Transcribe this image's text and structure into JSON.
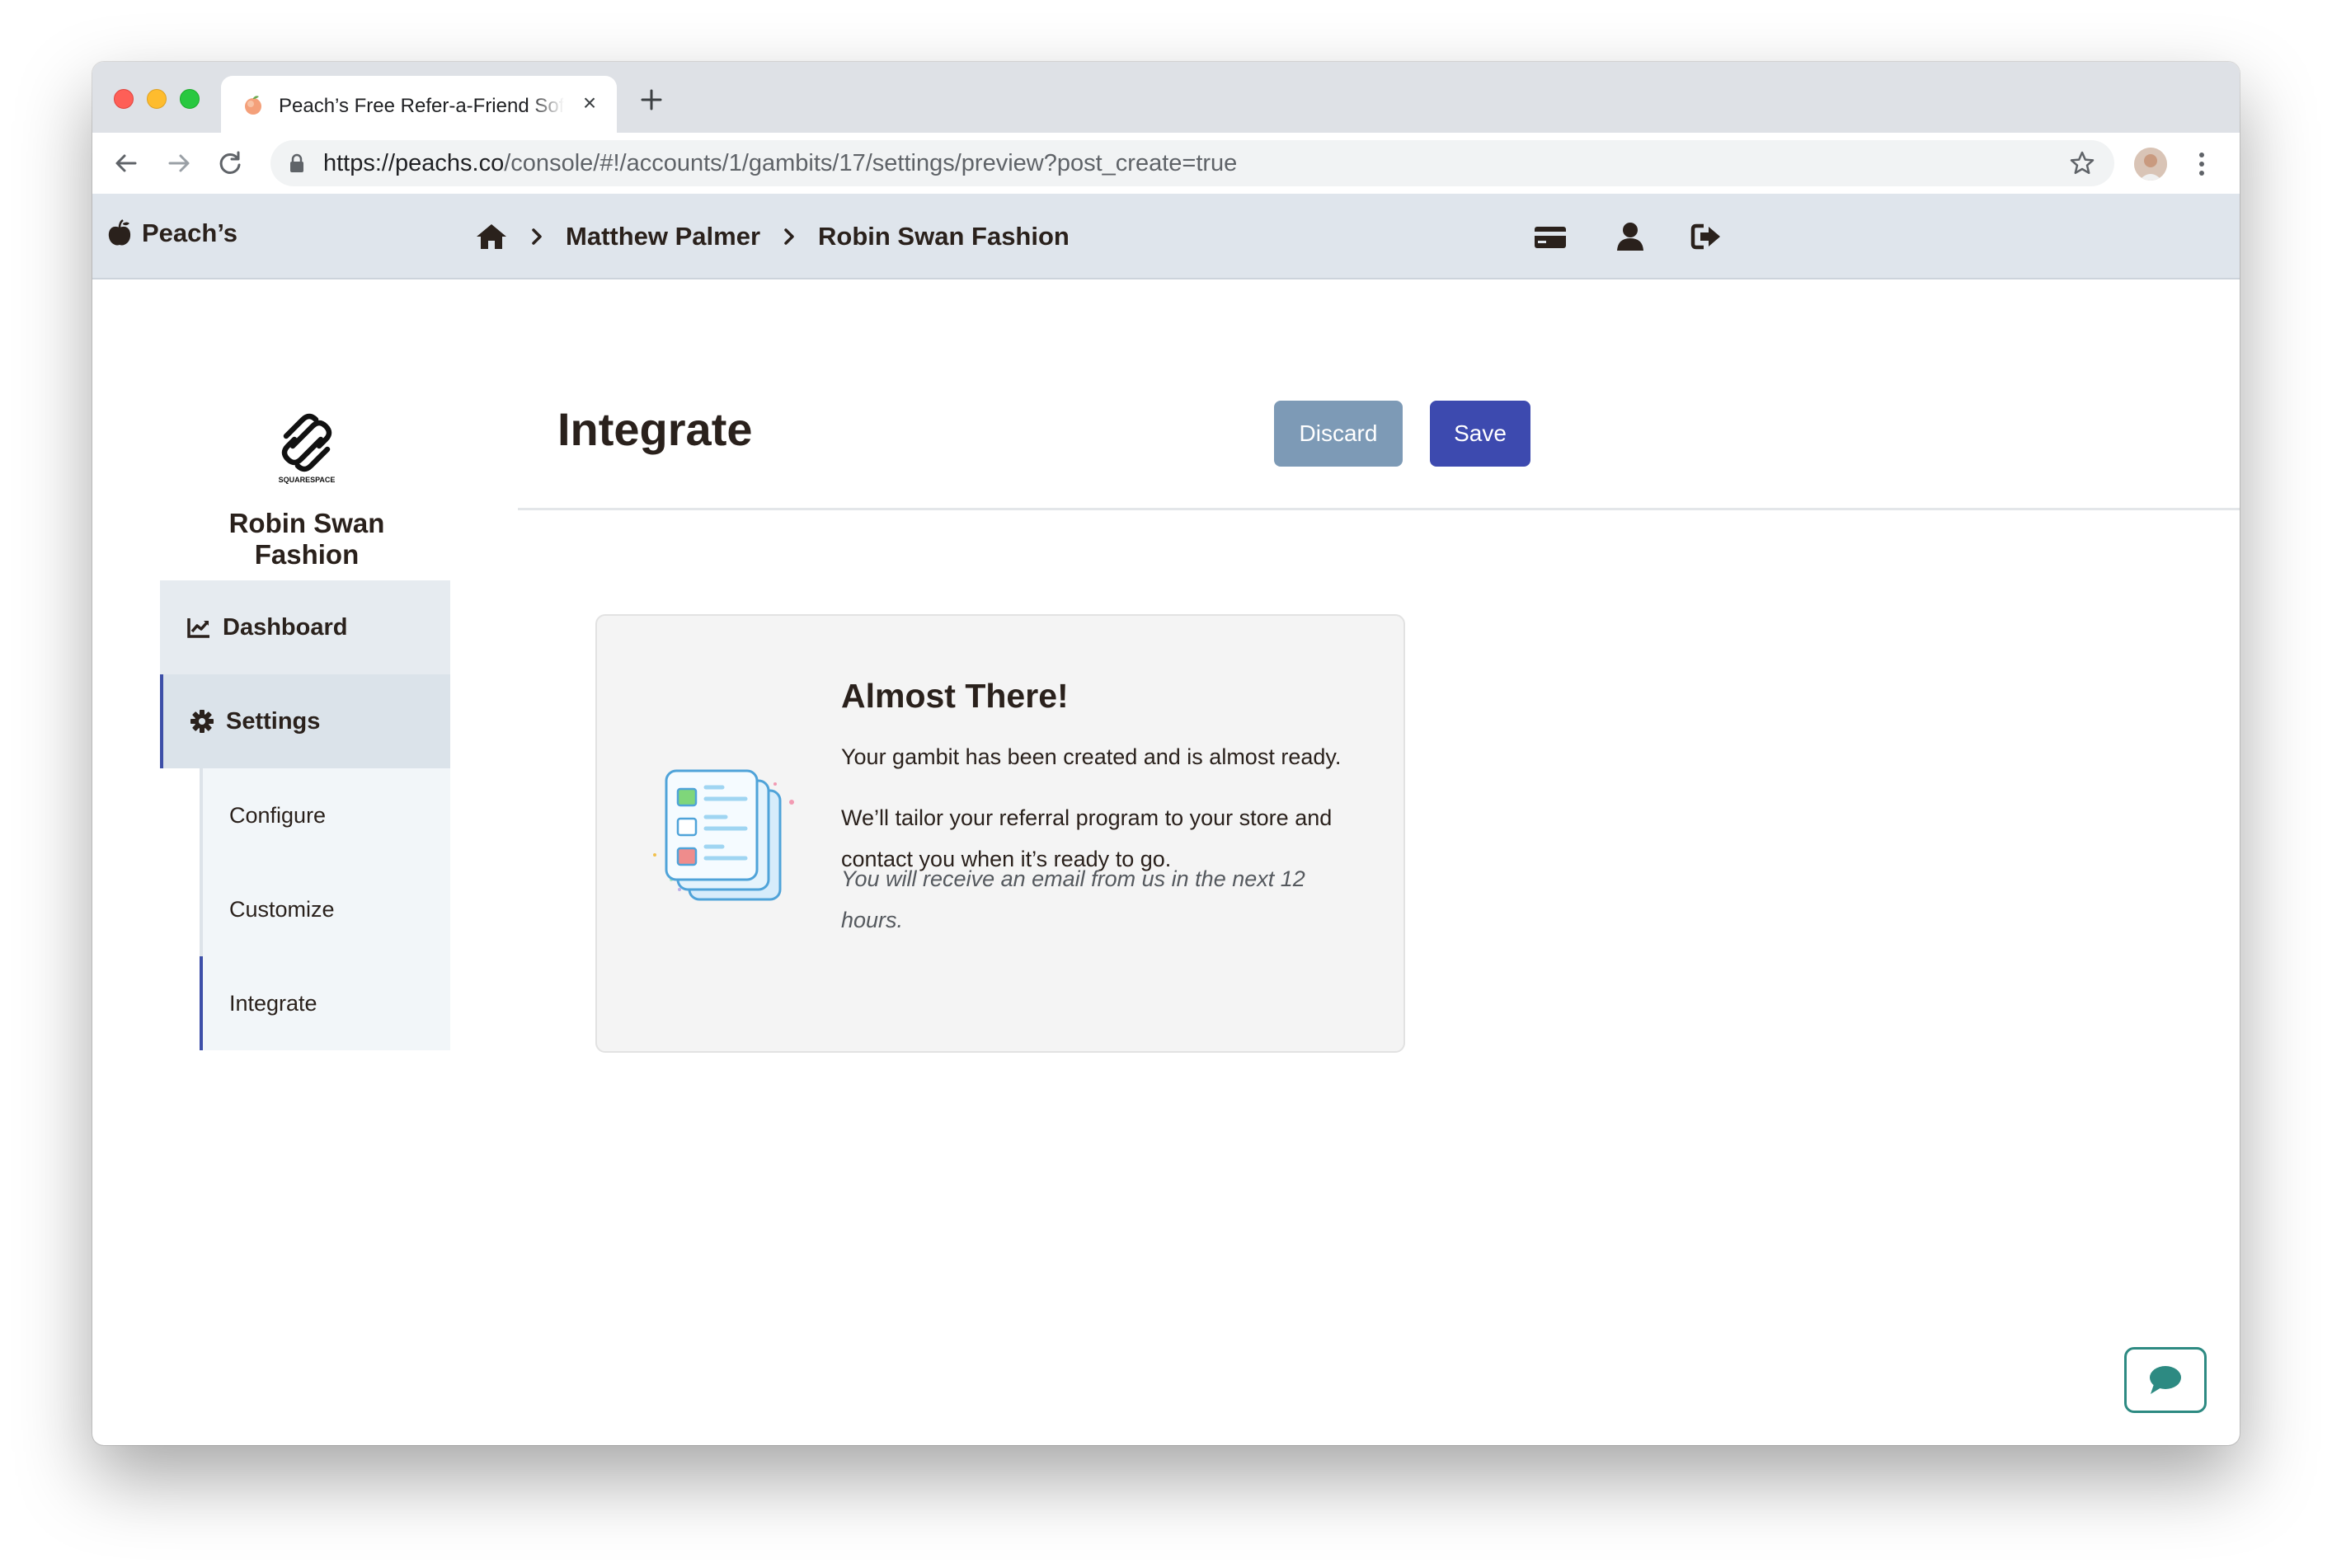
{
  "browser": {
    "tab_title": "Peach’s Free Refer-a-Friend Software",
    "tab_close": "×",
    "url_host": "https://peachs.co",
    "url_path": "/console/#!/accounts/1/gambits/17/settings/preview?post_create=true"
  },
  "header": {
    "brand": "Peach’s",
    "breadcrumbs": [
      "Matthew Palmer",
      "Robin Swan Fashion"
    ]
  },
  "sidebar": {
    "logo_text": "SQUARESPACE",
    "store_name": "Robin Swan Fashion",
    "items": [
      {
        "label": "Dashboard",
        "icon": "line-chart-icon"
      },
      {
        "label": "Settings",
        "icon": "gear-icon"
      }
    ],
    "sub_items": [
      {
        "label": "Configure"
      },
      {
        "label": "Customize"
      },
      {
        "label": "Integrate",
        "active": true
      }
    ]
  },
  "main": {
    "title": "Integrate",
    "discard_label": "Discard",
    "save_label": "Save",
    "card": {
      "title": "Almost There!",
      "line1": "Your gambit has been created and is almost ready.",
      "line2": "We’ll tailor your referral program to your store and contact you when it’s ready to go.",
      "note": "You will receive an email from us in the next 12 hours."
    }
  },
  "colors": {
    "primary": "#3d4aaf",
    "secondary": "#7d9ab6",
    "header_bg": "#dfe5ec",
    "chat_accent": "#2d8a82"
  }
}
